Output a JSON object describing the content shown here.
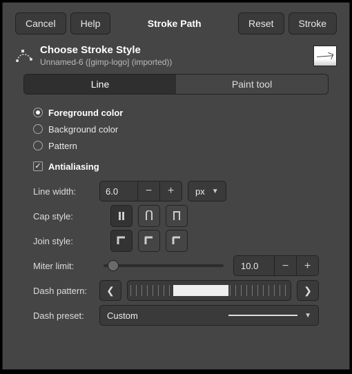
{
  "buttons": {
    "cancel": "Cancel",
    "help": "Help",
    "title": "Stroke Path",
    "reset": "Reset",
    "stroke": "Stroke"
  },
  "header": {
    "title": "Choose Stroke Style",
    "subtitle": "Unnamed-6 ([gimp-logo] (imported))"
  },
  "tabs": {
    "line": "Line",
    "paint": "Paint tool"
  },
  "radios": {
    "fg": "Foreground color",
    "bg": "Background color",
    "pattern": "Pattern"
  },
  "antialias": "Antialiasing",
  "labels": {
    "linewidth": "Line width:",
    "capstyle": "Cap style:",
    "joinstyle": "Join style:",
    "miterlimit": "Miter limit:",
    "dashpattern": "Dash pattern:",
    "dashpreset": "Dash preset:"
  },
  "values": {
    "linewidth": "6.0",
    "unit": "px",
    "miter": "10.0",
    "preset": "Custom"
  }
}
